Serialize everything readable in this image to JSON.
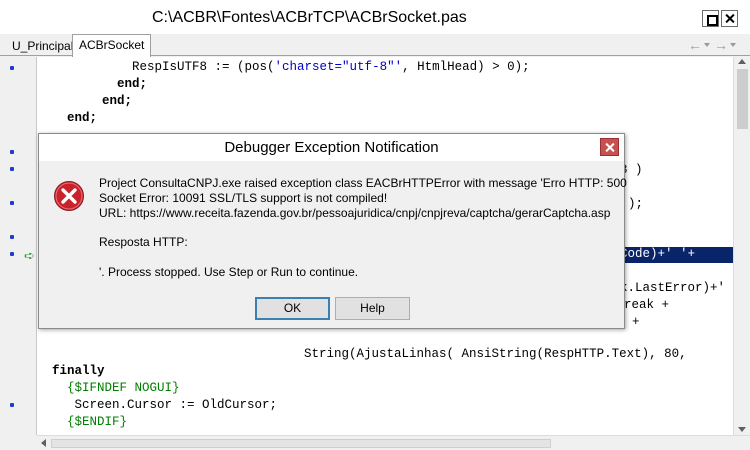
{
  "window": {
    "title": "C:\\ACBR\\Fontes\\ACBrTCP\\ACBrSocket.pas"
  },
  "tabs": [
    {
      "label": "U_Principal"
    },
    {
      "label": "ACBrSocket"
    }
  ],
  "nav": {
    "back_icon": "←",
    "forward_icon": "→"
  },
  "code": {
    "lines": [
      [
        "        RespIsUTF8 := (pos(",
        "'charset=\"utf-8\"'",
        ", HtmlHead) > 0);"
      ],
      [
        "      end;"
      ],
      [
        "    end;"
      ],
      [
        "  end;"
      ],
      [
        "8 )"
      ],
      [
        ");"
      ],
      [
        "Code)+' '+"
      ],
      [
        "k.LastError)+'"
      ],
      [
        "reak +"
      ],
      [
        "+"
      ],
      [
        "                    String(AjustaLinhas( AnsiString(RespHTTP.Text), 80,"
      ],
      [
        "finally"
      ],
      [
        "  {$IFNDEF NOGUI}"
      ],
      [
        "   Screen.Cursor := OldCursor;"
      ],
      [
        "  {$ENDIF}"
      ]
    ]
  },
  "dialog": {
    "title": "Debugger Exception Notification",
    "message_lines": [
      "Project ConsultaCNPJ.exe raised exception class EACBrHTTPError with message 'Erro HTTP: 500",
      "Socket Error: 10091 SSL/TLS support is not compiled!",
      "URL: https://www.receita.fazenda.gov.br/pessoajuridica/cnpj/cnpjreva/captcha/gerarCaptcha.asp",
      "Resposta HTTP:",
      "'. Process stopped. Use Step or Run to continue."
    ],
    "ok_label": "OK",
    "help_label": "Help"
  },
  "colors": {
    "keyword": "#000000",
    "string": "#0000c8",
    "directive": "#008000",
    "selection": "#0a246a",
    "error_icon": "#c8232c",
    "dialog_close": "#c75050"
  }
}
